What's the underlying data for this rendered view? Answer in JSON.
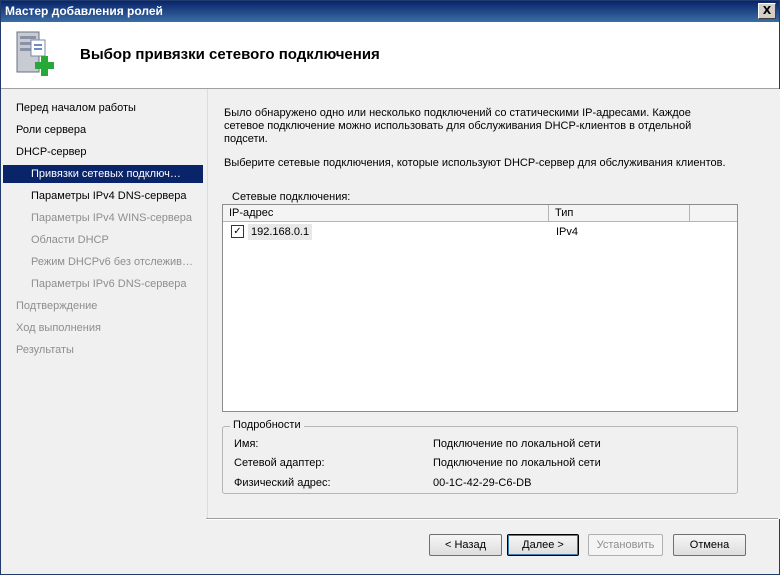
{
  "window": {
    "title": "Мастер добавления ролей",
    "close_glyph": "X"
  },
  "header": {
    "title": "Выбор привязки сетевого подключения",
    "icon": "server-add-icon"
  },
  "sidebar": {
    "items": [
      {
        "label": "Перед началом работы",
        "state": "normal"
      },
      {
        "label": "Роли сервера",
        "state": "normal"
      },
      {
        "label": "DHCP-сервер",
        "state": "normal"
      },
      {
        "label": "Привязки сетевых подключ…",
        "state": "selected"
      },
      {
        "label": "Параметры IPv4 DNS-сервера",
        "state": "normal"
      },
      {
        "label": "Параметры IPv4 WINS-сервера",
        "state": "disabled"
      },
      {
        "label": "Области DHCP",
        "state": "disabled"
      },
      {
        "label": "Режим DHCPv6 без отслежив…",
        "state": "disabled"
      },
      {
        "label": "Параметры IPv6 DNS-сервера",
        "state": "disabled"
      },
      {
        "label": "Подтверждение",
        "state": "disabled"
      },
      {
        "label": "Ход выполнения",
        "state": "disabled"
      },
      {
        "label": "Результаты",
        "state": "disabled"
      }
    ]
  },
  "main": {
    "description": "Было обнаружено одно или несколько подключений со статическими IP-адресами. Каждое сетевое подключение можно использовать для обслуживания DHCP-клиентов в отдельной подсети.",
    "instruction": "Выберите сетевые подключения, которые используют DHCP-сервер для обслуживания клиентов.",
    "connections_label": "Сетевые подключения:",
    "columns": [
      "IP-адрес",
      "Тип"
    ],
    "rows": [
      {
        "checked": true,
        "ip": "192.168.0.1",
        "type": "IPv4"
      }
    ],
    "details": {
      "legend": "Подробности",
      "name_label": "Имя:",
      "name_value": "Подключение по локальной сети",
      "adapter_label": "Сетевой адаптер:",
      "adapter_value": "Подключение по локальной сети",
      "mac_label": "Физический адрес:",
      "mac_value": "00-1C-42-29-C6-DB"
    }
  },
  "buttons": {
    "back": "< Назад",
    "next": "Далее >",
    "install": "Установить",
    "cancel": "Отмена"
  }
}
